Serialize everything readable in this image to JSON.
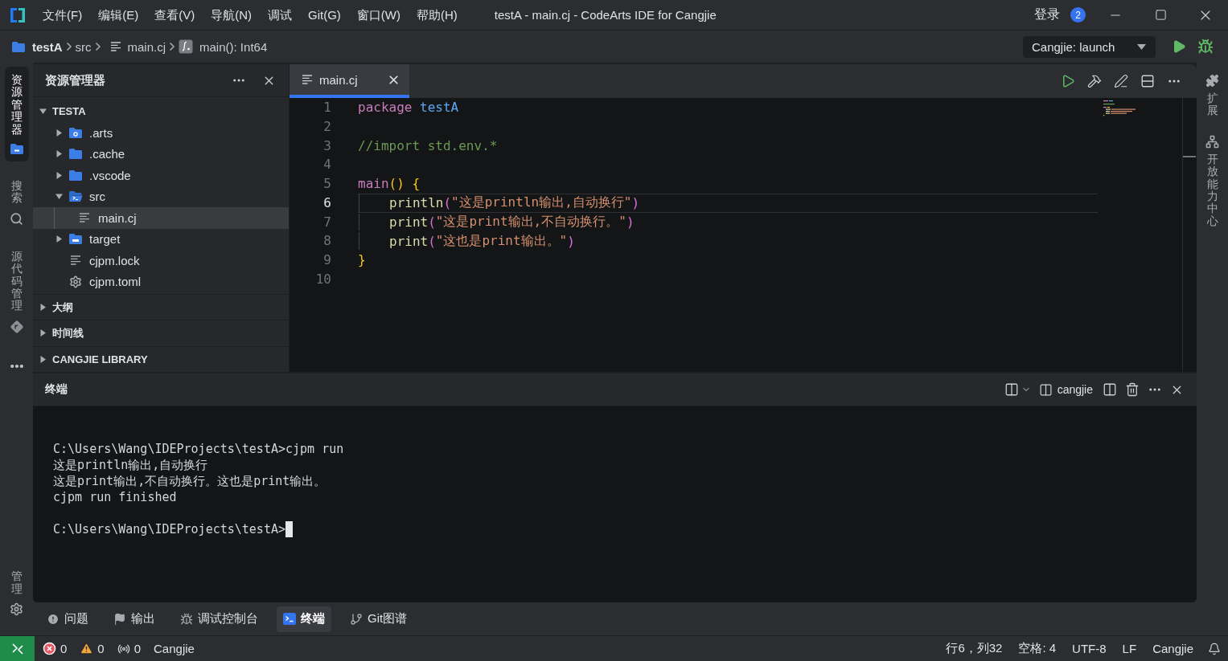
{
  "title_bar": {
    "menu": [
      "文件(F)",
      "编辑(E)",
      "查看(V)",
      "导航(N)",
      "调试",
      "Git(G)",
      "窗口(W)",
      "帮助(H)"
    ],
    "title": "testA - main.cj - CodeArts IDE for Cangjie",
    "login": "登录",
    "badge": "2"
  },
  "breadcrumb": {
    "items": [
      {
        "kind": "project",
        "label": "testA"
      },
      {
        "kind": "folder",
        "label": "src"
      },
      {
        "kind": "file",
        "label": "main.cj"
      },
      {
        "kind": "function",
        "label": "main(): Int64"
      }
    ],
    "run_config": "Cangjie: launch"
  },
  "activity_bar": {
    "items": [
      {
        "kind": "explorer",
        "label": "资源管理器",
        "selected": true
      },
      {
        "kind": "search",
        "label": "搜索",
        "selected": false
      },
      {
        "kind": "scm",
        "label": "源代码管理",
        "selected": false
      }
    ],
    "manage": "管理"
  },
  "explorer": {
    "title": "资源管理器",
    "tree": [
      {
        "kind": "root",
        "label": "TESTA",
        "expanded": true,
        "selected": false,
        "children": [
          {
            "kind": "arts",
            "label": ".arts",
            "expanded": false,
            "selected": false
          },
          {
            "kind": "folder",
            "label": ".cache",
            "expanded": false,
            "selected": false
          },
          {
            "kind": "folder",
            "label": ".vscode",
            "expanded": false,
            "selected": false
          },
          {
            "kind": "source",
            "label": "src",
            "expanded": true,
            "selected": false,
            "children": [
              {
                "kind": "file",
                "label": "main.cj",
                "selected": true
              }
            ]
          },
          {
            "kind": "target",
            "label": "target",
            "expanded": false,
            "selected": false
          },
          {
            "kind": "file",
            "label": "cjpm.lock",
            "selected": false
          },
          {
            "kind": "config",
            "label": "cjpm.toml",
            "selected": false
          }
        ]
      }
    ],
    "sections": [
      {
        "label": "大纲",
        "expanded": false
      },
      {
        "label": "时间线",
        "expanded": false
      },
      {
        "label": "CANGJIE LIBRARY",
        "expanded": false
      }
    ]
  },
  "editor": {
    "tabs": [
      {
        "label": "main.cj",
        "selected": true
      }
    ],
    "lines": [
      {
        "number": "1",
        "current": false,
        "indented": false,
        "tokens": [
          {
            "kind": "keyword",
            "text": "package"
          },
          {
            "kind": "identifier",
            "text": " testA"
          }
        ]
      },
      {
        "number": "2",
        "current": false,
        "indented": false
      },
      {
        "number": "3",
        "current": false,
        "indented": false,
        "tokens": [
          {
            "kind": "comment",
            "text": "//import std.env.*"
          }
        ]
      },
      {
        "number": "4",
        "current": false,
        "indented": false
      },
      {
        "number": "5",
        "current": false,
        "indented": false,
        "tokens": [
          {
            "kind": "keyword",
            "text": "main"
          },
          {
            "kind": "bracket",
            "text": "() {"
          }
        ]
      },
      {
        "number": "6",
        "current": true,
        "indented": true,
        "tokens": [
          {
            "kind": "function",
            "text": "println"
          },
          {
            "kind": "paren",
            "text": "("
          },
          {
            "kind": "string",
            "text": "\"这是println输出,自动换行\""
          },
          {
            "kind": "paren",
            "text": ")"
          }
        ]
      },
      {
        "number": "7",
        "current": false,
        "indented": true,
        "tokens": [
          {
            "kind": "function",
            "text": "print"
          },
          {
            "kind": "paren",
            "text": "("
          },
          {
            "kind": "string",
            "text": "\"这是print输出,不自动换行。\""
          },
          {
            "kind": "paren",
            "text": ")"
          }
        ]
      },
      {
        "number": "8",
        "current": false,
        "indented": true,
        "tokens": [
          {
            "kind": "function",
            "text": "print"
          },
          {
            "kind": "paren",
            "text": "("
          },
          {
            "kind": "string",
            "text": "\"这也是print输出。\""
          },
          {
            "kind": "paren",
            "text": ")"
          }
        ]
      },
      {
        "number": "9",
        "current": false,
        "indented": false,
        "tokens": [
          {
            "kind": "bracket",
            "text": "}"
          }
        ]
      },
      {
        "number": "10",
        "current": false,
        "indented": false
      }
    ]
  },
  "right_bar": {
    "items": [
      {
        "kind": "extensions",
        "label": "扩展"
      },
      {
        "kind": "capabilities",
        "label": "开放能力中心"
      }
    ]
  },
  "panel": {
    "title": "终端",
    "terminal_name": "cangjie",
    "output": [
      "C:\\Users\\Wang\\IDEProjects\\testA>cjpm run",
      "这是println输出,自动换行",
      "这是print输出,不自动换行。这也是print输出。",
      "cjpm run finished"
    ],
    "prompt": "C:\\Users\\Wang\\IDEProjects\\testA>",
    "cursor": true,
    "tabs": [
      {
        "kind": "problems",
        "label": "问题",
        "selected": false
      },
      {
        "kind": "output",
        "label": "输出",
        "selected": false
      },
      {
        "kind": "debug",
        "label": "调试控制台",
        "selected": false
      },
      {
        "kind": "terminal",
        "label": "终端",
        "selected": true
      },
      {
        "kind": "git",
        "label": "Git图谱",
        "selected": false
      }
    ]
  },
  "status_bar": {
    "left": [
      {
        "kind": "errors",
        "label": "0"
      },
      {
        "kind": "warnings",
        "label": "0"
      },
      {
        "kind": "ports",
        "label": "0"
      },
      {
        "kind": "language",
        "label": "Cangjie"
      }
    ],
    "right": [
      "行6，列32",
      "空格: 4",
      "UTF-8",
      "LF",
      "Cangjie"
    ]
  }
}
